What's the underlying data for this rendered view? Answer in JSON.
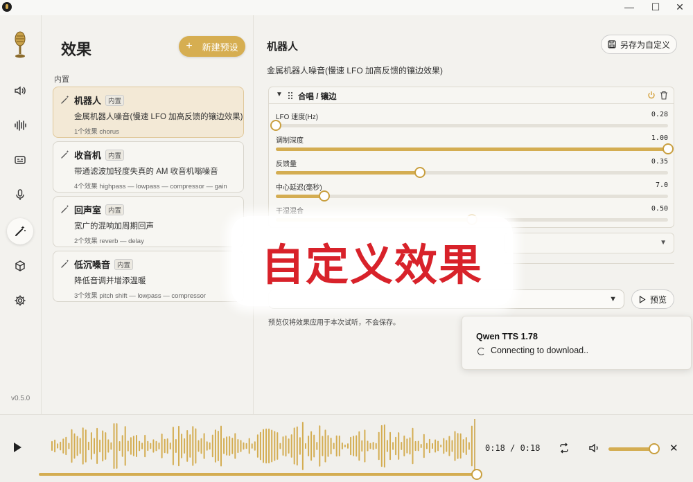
{
  "window": {
    "minimize": "—",
    "maximize": "☐",
    "close": "✕"
  },
  "rail": {
    "items": [
      {
        "name": "speaker",
        "active": false
      },
      {
        "name": "waveform",
        "active": false
      },
      {
        "name": "subtitles",
        "active": false
      },
      {
        "name": "microphone",
        "active": false
      },
      {
        "name": "magic-wand",
        "active": true
      },
      {
        "name": "cube",
        "active": false
      },
      {
        "name": "gear",
        "active": false
      }
    ],
    "version": "v0.5.0"
  },
  "effects_panel": {
    "title": "效果",
    "new_preset_label": "新建预设",
    "new_preset_icon": "+",
    "section_label": "内置",
    "presets": [
      {
        "name": "机器人",
        "badge": "内置",
        "description": "金属机器人噪音(慢速 LFO 加高反馈的镶边效果)",
        "meta": "1个效果   chorus",
        "selected": true
      },
      {
        "name": "收音机",
        "badge": "内置",
        "description": "带通滤波加轻度失真的 AM 收音机嗡噪音",
        "meta": "4个效果   highpass — lowpass — compressor — gain",
        "selected": false
      },
      {
        "name": "回声室",
        "badge": "内置",
        "description": "宽广的混响加周期回声",
        "meta": "2个效果   reverb — delay",
        "selected": false
      },
      {
        "name": "低沉嗓音",
        "badge": "内置",
        "description": "降低音调并增添温暖",
        "meta": "3个效果   pitch shift — lowpass — compressor",
        "selected": false
      }
    ]
  },
  "detail": {
    "title": "机器人",
    "save_custom_label": "另存为自定义",
    "description": "金属机器人噪音(慢速 LFO 加高反馈的镶边效果)",
    "effect": {
      "name": "合唱 / 镶边",
      "params": [
        {
          "label": "LFO 速度(Hz)",
          "value": "0.28",
          "fraction": 0.0
        },
        {
          "label": "调制深度",
          "value": "1.00",
          "fraction": 1.0
        },
        {
          "label": "反馈量",
          "value": "0.35",
          "fraction": 0.367
        },
        {
          "label": "中心延迟(毫秒)",
          "value": "7.0",
          "fraction": 0.124
        },
        {
          "label": "干湿混合",
          "value": "0.50",
          "fraction": 0.5
        }
      ]
    },
    "preview_label": "预览",
    "preview_note": "预览仅将效果应用于本次试听，不会保存。"
  },
  "toast": {
    "title": "Qwen TTS 1.78",
    "message": "Connecting to download.."
  },
  "overlay": {
    "caption": "自定义效果"
  },
  "player": {
    "time": "0:18 / 0:18",
    "progress": 1.0,
    "volume": 1.0
  },
  "colors": {
    "accent": "#d4ad52",
    "caption": "#d8222a"
  }
}
